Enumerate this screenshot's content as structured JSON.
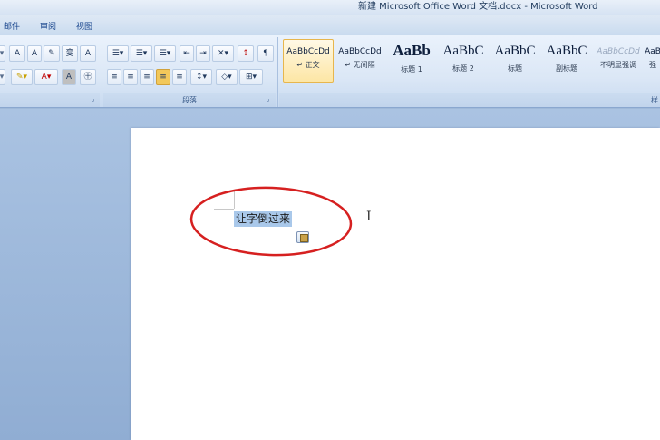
{
  "window": {
    "title": "新建 Microsoft Office Word 文档.docx - Microsoft Word"
  },
  "menu_tabs": [
    "邮件",
    "审阅",
    "视图"
  ],
  "ribbon": {
    "font_group": {
      "buttons": [
        "A",
        "A",
        "变",
        "A"
      ],
      "row2_buttons": [
        "A",
        "㊉"
      ]
    },
    "paragraph_group": {
      "label": "段落"
    },
    "styles_gallery": [
      {
        "sample": "AaBbCcDd",
        "name": "↵ 正文",
        "active": true
      },
      {
        "sample": "AaBbCcDd",
        "name": "↵ 无间隔"
      },
      {
        "sample": "AaBb",
        "name": "标题 1"
      },
      {
        "sample": "AaBbC",
        "name": "标题 2"
      },
      {
        "sample": "AaBbC",
        "name": "标题"
      },
      {
        "sample": "AaBbC",
        "name": "副标题"
      },
      {
        "sample": "AaBbCcDd",
        "name": "不明显强调"
      },
      {
        "sample": "AaB",
        "name": "强"
      }
    ],
    "styles_label": "样"
  },
  "document": {
    "selected_text": "让字倒过来"
  },
  "colors": {
    "annotation_circle": "#d62020",
    "selection": "#a9c8ea"
  }
}
